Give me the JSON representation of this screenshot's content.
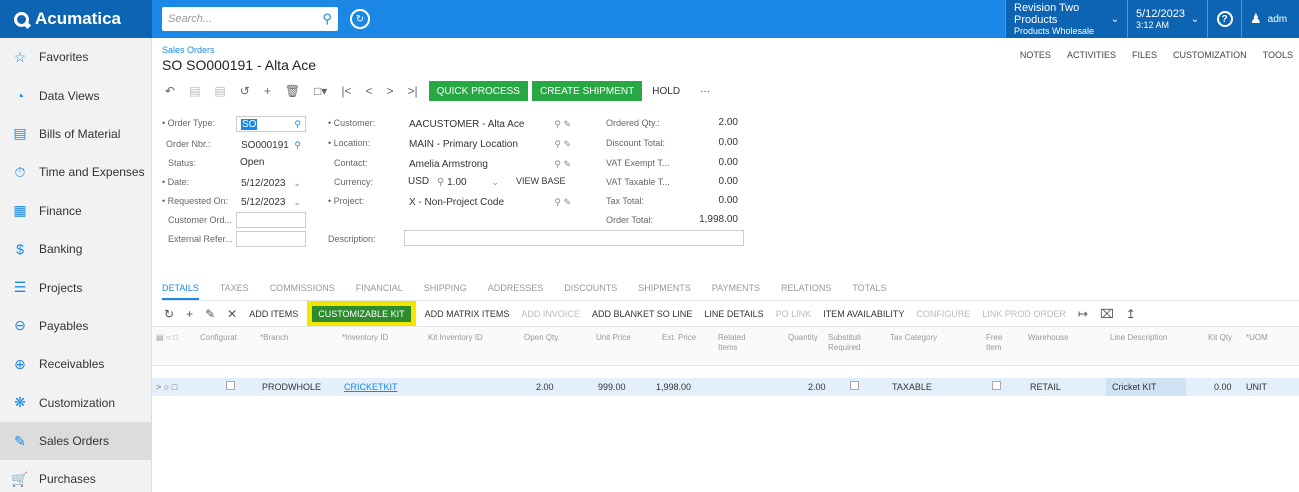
{
  "app": {
    "logo": "Acumatica"
  },
  "search": {
    "placeholder": "Search..."
  },
  "company": {
    "name": "Revision Two Products",
    "branch": "Products Wholesale"
  },
  "datetime": {
    "date": "5/12/2023",
    "time": "3:12 AM"
  },
  "user": {
    "name": "adm"
  },
  "sidebar": {
    "items": [
      {
        "label": "Favorites",
        "icon": "star-icon"
      },
      {
        "label": "Data Views",
        "icon": "pie-chart-icon"
      },
      {
        "label": "Bills of Material",
        "icon": "document-icon"
      },
      {
        "label": "Time and Expenses",
        "icon": "stopwatch-icon"
      },
      {
        "label": "Finance",
        "icon": "calculator-icon"
      },
      {
        "label": "Banking",
        "icon": "dollar-icon"
      },
      {
        "label": "Projects",
        "icon": "signpost-icon"
      },
      {
        "label": "Payables",
        "icon": "minus-circle-icon"
      },
      {
        "label": "Receivables",
        "icon": "plus-circle-icon"
      },
      {
        "label": "Customization",
        "icon": "puzzle-icon"
      },
      {
        "label": "Sales Orders",
        "icon": "pencil-box-icon"
      },
      {
        "label": "Purchases",
        "icon": "cart-icon"
      }
    ]
  },
  "page": {
    "breadcrumb": "Sales Orders",
    "title": "SO SO000191 - Alta Ace",
    "links": [
      "NOTES",
      "ACTIVITIES",
      "FILES",
      "CUSTOMIZATION",
      "TOOLS"
    ]
  },
  "toolbar": {
    "quick_process": "QUICK PROCESS",
    "create_shipment": "CREATE SHIPMENT",
    "hold": "HOLD",
    "more": "···"
  },
  "form": {
    "order_type_label": "• Order Type:",
    "order_type": "SO",
    "order_nbr_label": "Order Nbr.:",
    "order_nbr": "SO000191",
    "status_label": "Status:",
    "status": "Open",
    "date_label": "• Date:",
    "date": "5/12/2023",
    "requested_on_label": "• Requested On:",
    "requested_on": "5/12/2023",
    "customer_ord_label": "Customer Ord...",
    "external_refer_label": "External Refer...",
    "customer_label": "• Customer:",
    "customer": "AACUSTOMER - Alta Ace",
    "location_label": "• Location:",
    "location": "MAIN - Primary Location",
    "contact_label": "Contact:",
    "contact": "Amelia Armstrong",
    "currency_label": "Currency:",
    "currency": "USD",
    "rate": "1.00",
    "view_base": "VIEW BASE",
    "project_label": "• Project:",
    "project": "X - Non-Project Code",
    "description_label": "Description:",
    "ordered_qty_label": "Ordered Qty.:",
    "ordered_qty": "2.00",
    "discount_total_label": "Discount Total:",
    "discount_total": "0.00",
    "vat_exempt_label": "VAT Exempt T...",
    "vat_exempt": "0.00",
    "vat_taxable_label": "VAT Taxable T...",
    "vat_taxable": "0.00",
    "tax_total_label": "Tax Total:",
    "tax_total": "0.00",
    "order_total_label": "Order Total:",
    "order_total": "1,998.00"
  },
  "tabs": [
    "DETAILS",
    "TAXES",
    "COMMISSIONS",
    "FINANCIAL",
    "SHIPPING",
    "ADDRESSES",
    "DISCOUNTS",
    "SHIPMENTS",
    "PAYMENTS",
    "RELATIONS",
    "TOTALS"
  ],
  "grid_toolbar": {
    "add_items": "ADD ITEMS",
    "customizable_kit": "CUSTOMIZABLE KIT",
    "add_matrix_items": "ADD MATRIX ITEMS",
    "add_invoice": "ADD INVOICE",
    "add_blanket": "ADD BLANKET SO LINE",
    "line_details": "LINE DETAILS",
    "po_link": "PO LINK",
    "item_availability": "ITEM AVAILABILITY",
    "configure": "CONFIGURE",
    "link_prod_order": "LINK PROD ORDER"
  },
  "grid": {
    "headers": {
      "configurat": "Configurat",
      "branch": "*Branch",
      "inventory_id": "*Inventory ID",
      "kit_inventory": "Kit Inventory ID",
      "open_qty": "Open Qty.",
      "unit_price": "Unit Price",
      "ext_price": "Ext. Price",
      "related_items": "Related Items",
      "quantity": "Quantity",
      "substitute": "Substituti Required",
      "tax_category": "Tax Category",
      "free_item": "Free Item",
      "warehouse": "Warehouse",
      "line_description": "Line Description",
      "kit_qty": "Kit Qty",
      "uom": "*UOM"
    },
    "row": {
      "branch": "PRODWHOLE",
      "inventory_id": "CRICKETKIT",
      "open_qty": "2.00",
      "unit_price": "999.00",
      "ext_price": "1,998.00",
      "quantity": "2.00",
      "tax_category": "TAXABLE",
      "warehouse": "RETAIL",
      "line_description": "Cricket KIT",
      "kit_qty": "0.00",
      "uom": "UNIT"
    }
  }
}
